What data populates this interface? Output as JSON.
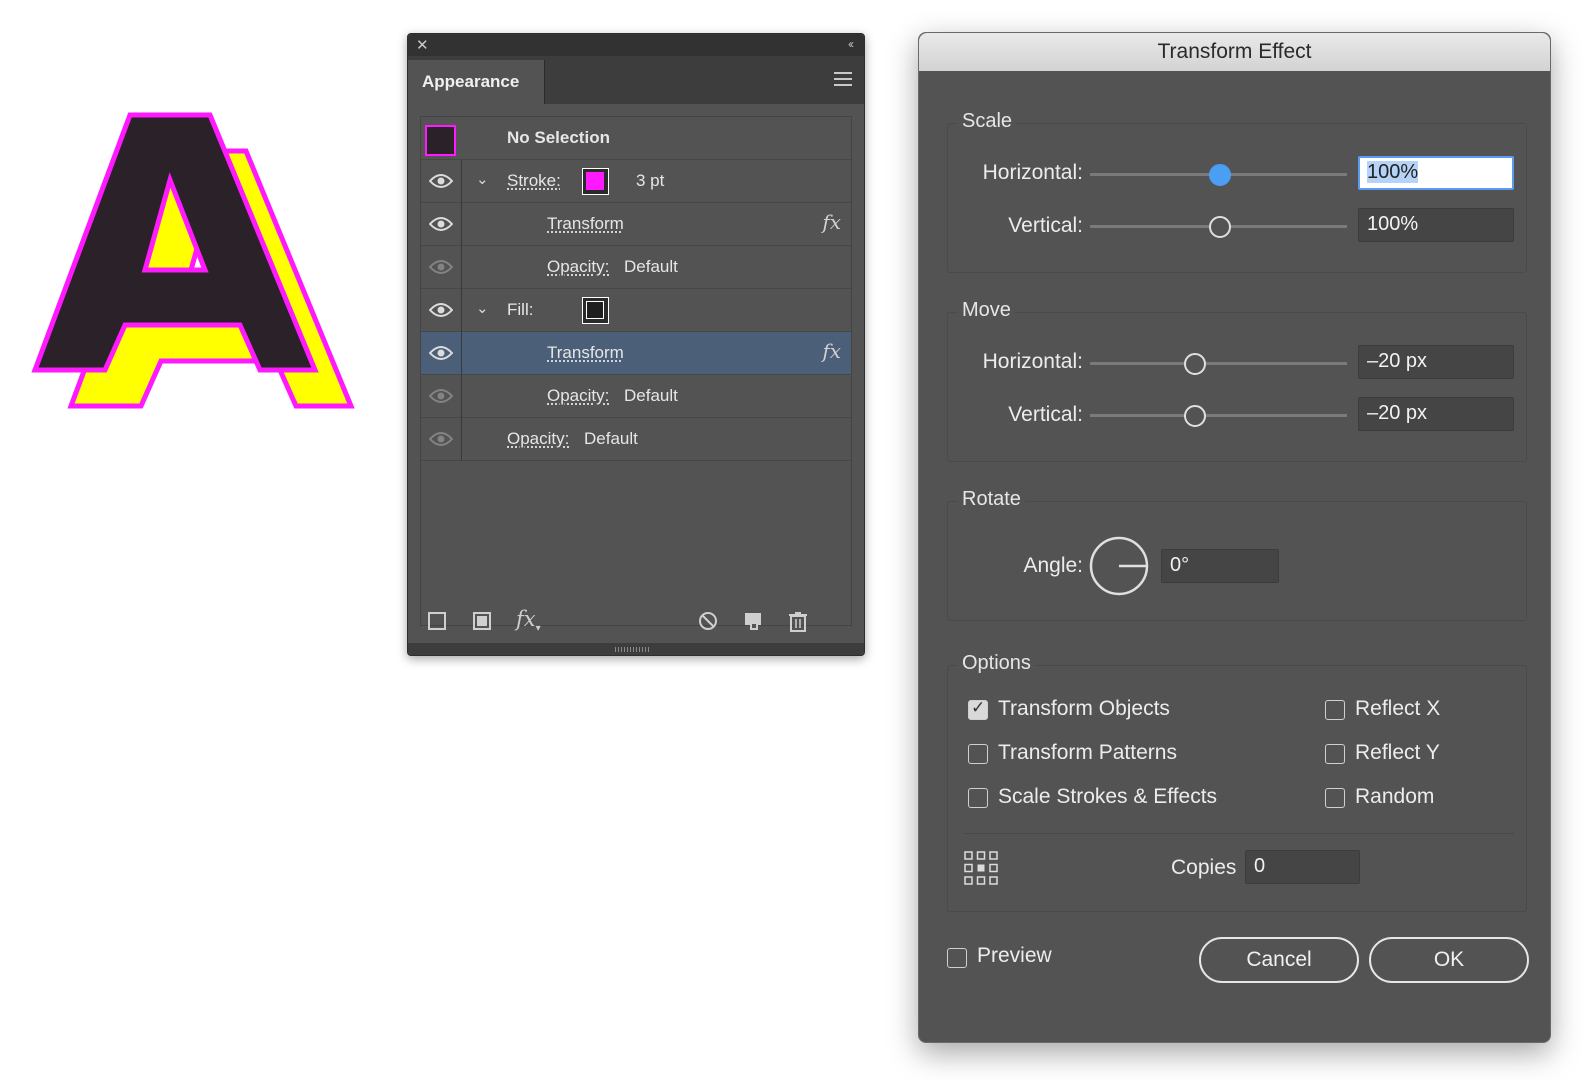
{
  "artwork": {
    "letter": "A",
    "colors": {
      "fill": "#2a2228",
      "stroke": "#ff19ff",
      "shadow": "#ffff00"
    }
  },
  "appearance_panel": {
    "tab_label": "Appearance",
    "close_icon": "close-icon",
    "collapse_icon": "double-chevron-left-icon",
    "menu_icon": "hamburger-menu-icon",
    "rows": [
      {
        "label": "No Selection"
      },
      {
        "label": "Stroke:",
        "value": "3 pt",
        "swatch_color": "#ff19ff"
      },
      {
        "label": "Transform",
        "icon": "fx-icon"
      },
      {
        "label": "Opacity:",
        "value": "Default"
      },
      {
        "label": "Fill:",
        "swatch_color": "#2a2a2a"
      },
      {
        "label": "Transform",
        "icon": "fx-icon",
        "selected": true
      },
      {
        "label": "Opacity:",
        "value": "Default"
      },
      {
        "label": "Opacity:",
        "value": "Default"
      }
    ],
    "selection_color": "#4b5f78",
    "bottom_icons": [
      "add-stroke-icon",
      "add-fill-icon",
      "fx-menu-icon",
      "clear-appearance-icon",
      "duplicate-item-icon",
      "trash-icon"
    ]
  },
  "transform_dialog": {
    "title": "Transform Effect",
    "scale": {
      "title": "Scale",
      "horizontal_label": "Horizontal:",
      "horizontal_value": "100%",
      "vertical_label": "Vertical:",
      "vertical_value": "100%"
    },
    "move": {
      "title": "Move",
      "horizontal_label": "Horizontal:",
      "horizontal_value": "–20 px",
      "vertical_label": "Vertical:",
      "vertical_value": "–20 px"
    },
    "rotate": {
      "title": "Rotate",
      "angle_label": "Angle:",
      "angle_value": "0°"
    },
    "options": {
      "title": "Options",
      "transform_objects": {
        "label": "Transform Objects",
        "checked": true
      },
      "transform_patterns": {
        "label": "Transform Patterns",
        "checked": false
      },
      "scale_strokes": {
        "label": "Scale Strokes & Effects",
        "checked": false
      },
      "reflect_x": {
        "label": "Reflect X",
        "checked": false
      },
      "reflect_y": {
        "label": "Reflect Y",
        "checked": false
      },
      "random": {
        "label": "Random",
        "checked": false
      },
      "copies_label": "Copies",
      "copies_value": "0",
      "reference_point_icon": "reference-point-locator-icon"
    },
    "preview": {
      "label": "Preview",
      "checked": false
    },
    "cancel_label": "Cancel",
    "ok_label": "OK"
  }
}
